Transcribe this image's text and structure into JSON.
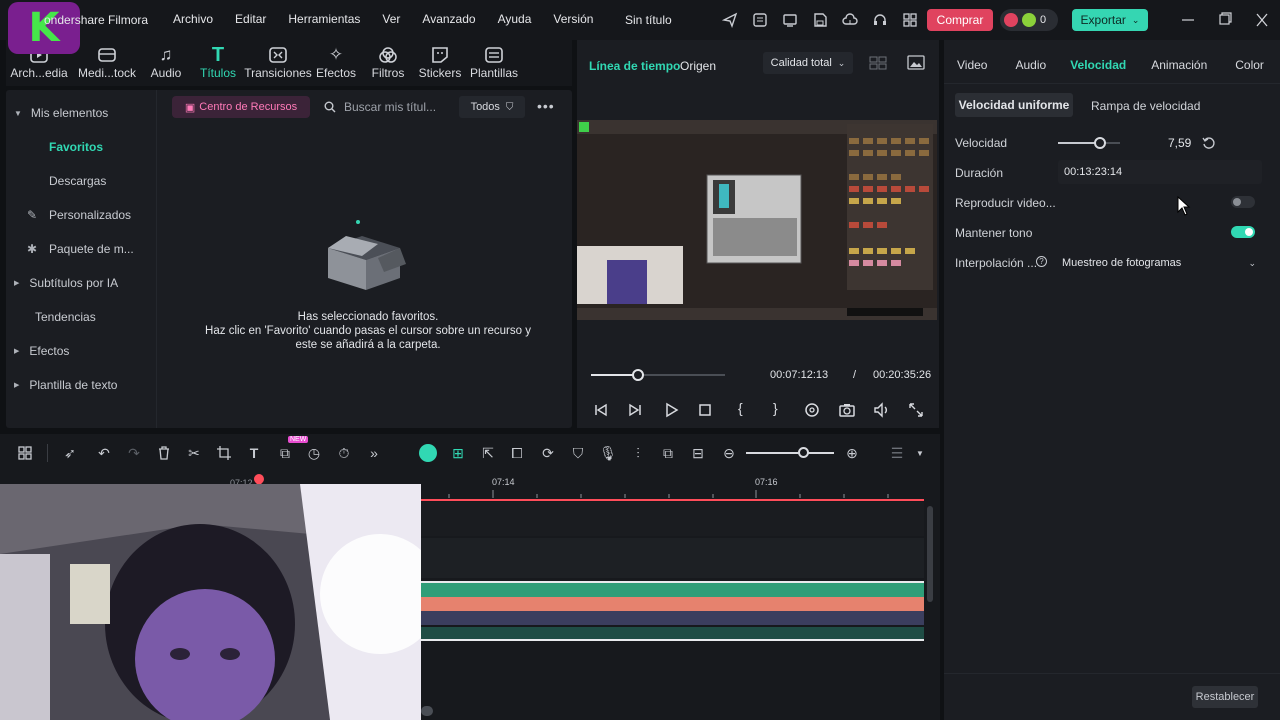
{
  "app": {
    "name": "ondershare Filmora",
    "project_title": "Sin título"
  },
  "menu": [
    "Archivo",
    "Editar",
    "Herramientas",
    "Ver",
    "Avanzado",
    "Ayuda",
    "Versión"
  ],
  "topbar": {
    "buy_label": "Comprar",
    "badge_count": "0",
    "export_label": "Exportar"
  },
  "tool_tabs": [
    {
      "label": "Arch...edia",
      "icon": "media-icon"
    },
    {
      "label": "Medi...tock",
      "icon": "stock-media-icon"
    },
    {
      "label": "Audio",
      "icon": "music-note-icon"
    },
    {
      "label": "Títulos",
      "icon": "text-t-icon",
      "active": true
    },
    {
      "label": "Transiciones",
      "icon": "transition-icon"
    },
    {
      "label": "Efectos",
      "icon": "effects-icon"
    },
    {
      "label": "Filtros",
      "icon": "filters-icon"
    },
    {
      "label": "Stickers",
      "icon": "sticker-icon"
    },
    {
      "label": "Plantillas",
      "icon": "templates-icon"
    }
  ],
  "sidebar": {
    "section": "Mis elementos",
    "items": [
      {
        "label": "Favoritos",
        "active": true
      },
      {
        "label": "Descargas"
      },
      {
        "label": "Personalizados"
      },
      {
        "label": "Paquete de m..."
      },
      {
        "label": "Subtítulos por IA"
      },
      {
        "label": "Tendencias"
      },
      {
        "label": "Efectos"
      },
      {
        "label": "Plantilla de texto"
      }
    ]
  },
  "resources": {
    "center_label": "Centro de Recursos",
    "search_placeholder": "Buscar mis títul...",
    "filter_label": "Todos",
    "empty_line1": "Has seleccionado favoritos.",
    "empty_line2": "Haz clic en 'Favorito' cuando pasas el cursor sobre un recurso y",
    "empty_line3": "este se añadirá a la carpeta."
  },
  "preview": {
    "tab_timeline": "Línea de tiempo",
    "tab_source": "Origen",
    "quality": "Calidad total",
    "current_time": "00:07:12:13",
    "separator": "/",
    "total_time": "00:20:35:26",
    "progress": 0.35
  },
  "right": {
    "tabs": [
      "Video",
      "Audio",
      "Velocidad",
      "Animación",
      "Color"
    ],
    "active_tab": "Velocidad",
    "subtab_uniform": "Velocidad uniforme",
    "subtab_ramp": "Rampa de velocidad",
    "speed_label": "Velocidad",
    "speed_value": "7,59",
    "speed_fraction": 0.68,
    "duration_label": "Duración",
    "duration_value": "00:13:23:14",
    "reverse_label": "Reproducir video...",
    "reverse_on": false,
    "keep_pitch_label": "Mantener tono",
    "keep_pitch_on": true,
    "interp_label": "Interpolación ...",
    "interp_value": "Muestreo de fotogramas",
    "reset_label": "Restablecer"
  },
  "timeline": {
    "ruler_labels": [
      "07:12",
      "07:14",
      "07:16"
    ],
    "new_badge": "NEW"
  },
  "colors": {
    "accent": "#31d8b3",
    "buy": "#e0435f",
    "playhead": "#ff4d5a",
    "audio_track": "#2f9e78",
    "video_track": "#e6826e"
  }
}
